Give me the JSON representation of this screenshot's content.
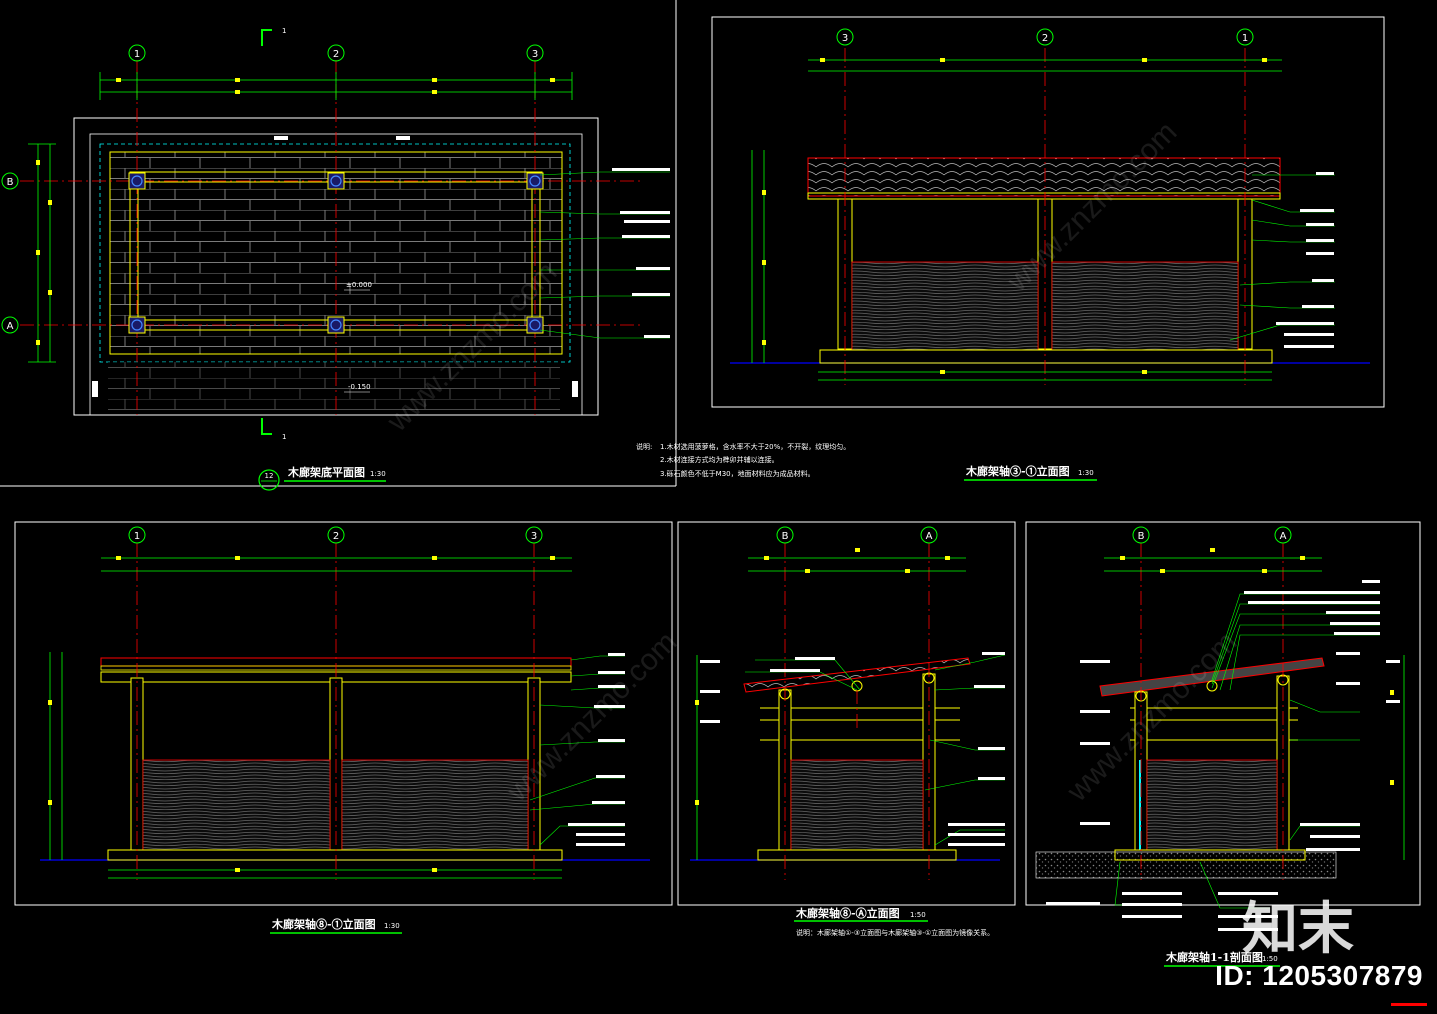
{
  "colors": {
    "background": "#000000",
    "frame": "#ffffff",
    "dimension": "#00ff00",
    "axis_line": "#ff0000",
    "timber": "#ffff00",
    "leader_label": "#ffffff",
    "ground": "#0000ff",
    "paving_dash": "#00ffff"
  },
  "plan": {
    "title": "木廊架底平面图",
    "scale": "1:30",
    "axes_h": [
      "1",
      "2",
      "3"
    ],
    "axes_v": [
      "B",
      "A"
    ],
    "elev_top": "±0.000",
    "elev_bottom": "-0.150",
    "section_mark": "1",
    "detail_symbol": "12"
  },
  "elevation_31": {
    "title": "木廊架轴③-①立面图",
    "scale": "1:30",
    "axes": [
      "3",
      "2",
      "1"
    ]
  },
  "notes": {
    "heading": "说明:",
    "lines": [
      "1.木材选用菠萝格，含水率不大于20%，不开裂，纹理均匀。",
      "2.木材连接方式均为榫卯并辅以连接。",
      "3.砾石颜色不低于M30，地面材料应为成品材料。"
    ]
  },
  "elevation_13": {
    "title": "木廊架轴⑧-①立面图",
    "scale": "1:30",
    "axes": [
      "1",
      "2",
      "3"
    ]
  },
  "elevation_BA": {
    "title": "木廊架轴⑧-Ⓐ立面图",
    "scale": "1:50",
    "axes": [
      "B",
      "A"
    ],
    "note": "说明：木廊架轴①-③立面图与木廊架轴③-①立面图为镜像关系。"
  },
  "section_11": {
    "title": "木廊架轴1-1剖面图",
    "scale": "1:50",
    "axes": [
      "B",
      "A"
    ]
  },
  "watermark": {
    "logo": "知末",
    "id": "ID: 1205307879",
    "site": "www.znzmo.com"
  }
}
